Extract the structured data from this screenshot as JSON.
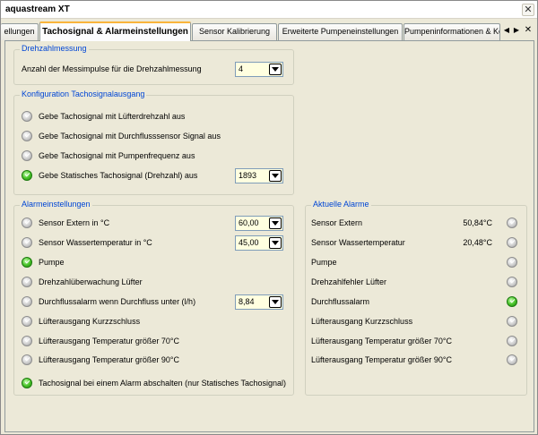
{
  "window": {
    "title": "aquastream XT",
    "close_label": "✕"
  },
  "tabs": [
    {
      "label": "ellungen"
    },
    {
      "label": "Tachosignal & Alarmeinstellungen"
    },
    {
      "label": "Sensor Kalibrierung"
    },
    {
      "label": "Erweiterte Pumpeneinstellungen"
    },
    {
      "label": "Pumpeninformationen & Ke"
    }
  ],
  "tab_controls": {
    "prev": "◀",
    "next": "▶",
    "close": "✕"
  },
  "drehzahl": {
    "legend": "Drehzahlmessung",
    "label": "Anzahl der Messimpulse für die Drehzahlmessung",
    "value": "4"
  },
  "tacho": {
    "legend": "Konfiguration Tachosignalausgang",
    "items": [
      {
        "label": "Gebe Tachosignal mit Lüfterdrehzahl aus",
        "state": "off"
      },
      {
        "label": "Gebe Tachosignal mit Durchflusssensor Signal aus",
        "state": "off"
      },
      {
        "label": "Gebe Tachosignal mit Pumpenfrequenz aus",
        "state": "off"
      },
      {
        "label": "Gebe Statisches Tachosignal (Drehzahl) aus",
        "state": "on"
      }
    ],
    "static_value": "1893"
  },
  "alarm_settings": {
    "legend": "Alarmeinstellungen",
    "items": [
      {
        "label": "Sensor Extern in °C",
        "state": "off"
      },
      {
        "label": "Sensor Wassertemperatur in °C",
        "state": "off"
      },
      {
        "label": "Pumpe",
        "state": "on"
      },
      {
        "label": "Drehzahlüberwachung Lüfter",
        "state": "off"
      },
      {
        "label": "Durchflussalarm wenn Durchfluss unter (l/h)",
        "state": "off"
      },
      {
        "label": "Lüfterausgang Kurzzschluss",
        "state": "off"
      },
      {
        "label": "Lüfterausgang Temperatur größer 70°C",
        "state": "off"
      },
      {
        "label": "Lüfterausgang Temperatur größer 90°C",
        "state": "off"
      },
      {
        "label": "Tachosignal bei einem Alarm abschalten (nur Statisches Tachosignal)",
        "state": "on"
      }
    ],
    "values": {
      "sensor_extern": "60,00",
      "wassertemperatur": "45,00",
      "durchfluss": "8,84"
    }
  },
  "current_alarms": {
    "legend": "Aktuelle Alarme",
    "items": [
      {
        "label": "Sensor Extern",
        "value": "50,84°C",
        "state": "off"
      },
      {
        "label": "Sensor Wassertemperatur",
        "value": "20,48°C",
        "state": "off"
      },
      {
        "label": "Pumpe",
        "value": "",
        "state": "off"
      },
      {
        "label": "Drehzahlfehler Lüfter",
        "value": "",
        "state": "off"
      },
      {
        "label": "Durchflussalarm",
        "value": "",
        "state": "on"
      },
      {
        "label": "Lüfterausgang Kurzzschluss",
        "value": "",
        "state": "off"
      },
      {
        "label": "Lüfterausgang Temperatur größer 70°C",
        "value": "",
        "state": "off"
      },
      {
        "label": "Lüfterausgang Temperatur größer 90°C",
        "value": "",
        "state": "off"
      }
    ]
  },
  "colors": {
    "group_legend": "#0046d5",
    "led_on": "#4cc52c",
    "led_off": "#b4b4b4",
    "input_bg": "#ffffe0",
    "active_tab_accent": "#f9b43c"
  }
}
